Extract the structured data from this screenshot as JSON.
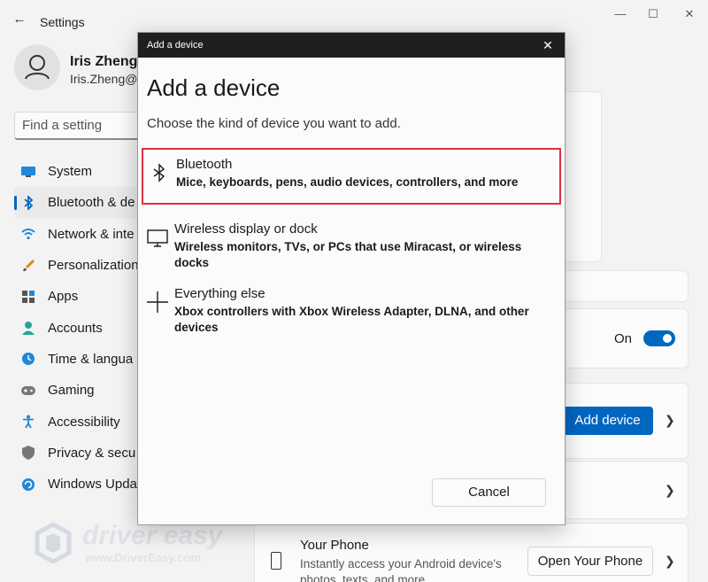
{
  "window": {
    "title": "Settings",
    "controls": {
      "minimize": "—",
      "maximize": "☐",
      "close": "✕"
    }
  },
  "profile": {
    "name": "Iris Zheng",
    "email": "Iris.Zheng@"
  },
  "search": {
    "placeholder": "Find a setting"
  },
  "sidebar": {
    "items": [
      {
        "label": "System",
        "icon": "monitor-icon"
      },
      {
        "label": "Bluetooth & de",
        "icon": "bluetooth-icon",
        "active": true
      },
      {
        "label": "Network & inte",
        "icon": "wifi-icon"
      },
      {
        "label": "Personalization",
        "icon": "brush-icon"
      },
      {
        "label": "Apps",
        "icon": "apps-icon"
      },
      {
        "label": "Accounts",
        "icon": "person-icon"
      },
      {
        "label": "Time & langua",
        "icon": "globe-clock-icon"
      },
      {
        "label": "Gaming",
        "icon": "gamepad-icon"
      },
      {
        "label": "Accessibility",
        "icon": "accessibility-icon"
      },
      {
        "label": "Privacy & secu",
        "icon": "shield-icon"
      },
      {
        "label": "Windows Upda",
        "icon": "update-icon"
      }
    ]
  },
  "main": {
    "bluetooth_toggle": {
      "label": "On",
      "on": true
    },
    "add_device_button": "Add device",
    "your_phone": {
      "title": "Your Phone",
      "description": "Instantly access your Android device's photos, texts, and more",
      "button": "Open Your Phone"
    }
  },
  "watermark": {
    "brand": "driver easy",
    "url": "www.DriverEasy.com"
  },
  "dialog": {
    "window_title": "Add a device",
    "heading": "Add a device",
    "subtitle": "Choose the kind of device you want to add.",
    "options": [
      {
        "title": "Bluetooth",
        "description": "Mice, keyboards, pens, audio devices, controllers, and more",
        "icon": "bluetooth-icon",
        "highlighted": true
      },
      {
        "title": "Wireless display or dock",
        "description": "Wireless monitors, TVs, or PCs that use Miracast, or wireless docks",
        "icon": "display-icon"
      },
      {
        "title": "Everything else",
        "description": "Xbox controllers with Xbox Wireless Adapter, DLNA, and other devices",
        "icon": "plus-icon"
      }
    ],
    "cancel_button": "Cancel"
  },
  "colors": {
    "accent": "#0067c0",
    "highlight_border": "#d9333f",
    "dialog_titlebar": "#1f1f1f"
  }
}
